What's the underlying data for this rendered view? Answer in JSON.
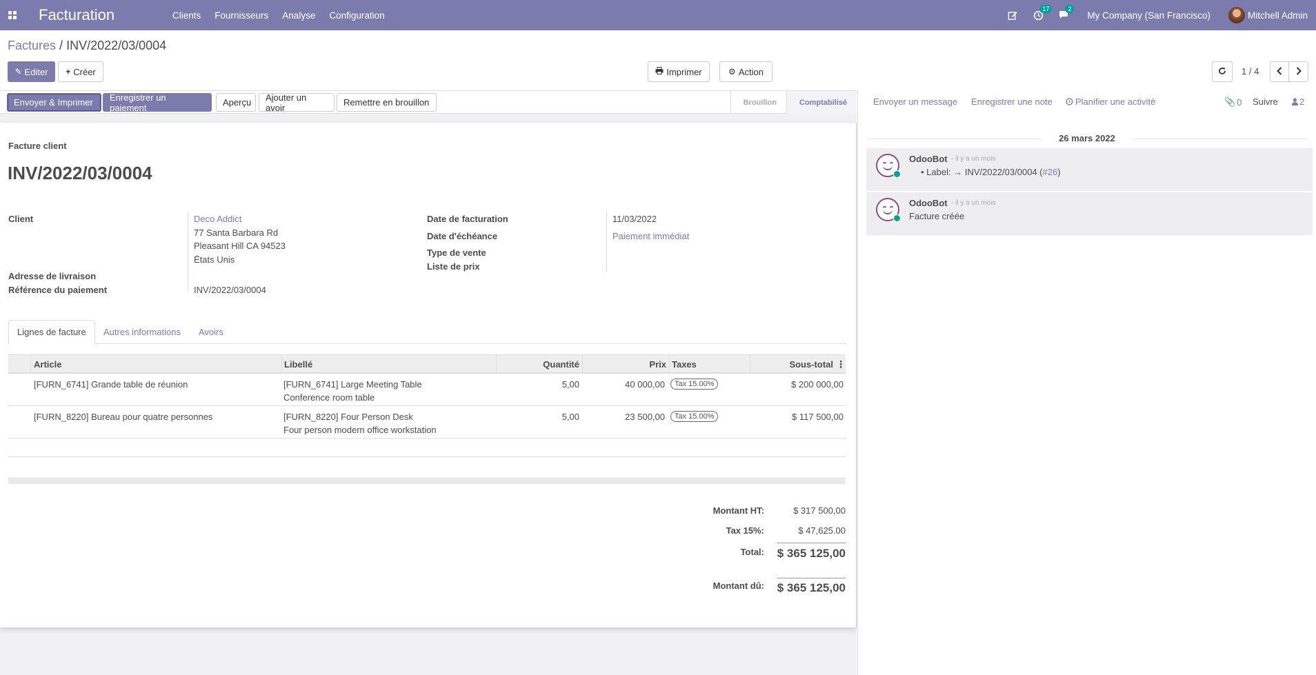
{
  "navbar": {
    "app_name": "Facturation",
    "menu": [
      "Clients",
      "Fournisseurs",
      "Analyse",
      "Configuration"
    ],
    "activity_count": "17",
    "message_count": "2",
    "company": "My Company (San Francisco)",
    "user": "Mitchell Admin"
  },
  "breadcrumb": {
    "parent": "Factures",
    "separator": "/",
    "current": "INV/2022/03/0004"
  },
  "control": {
    "edit_label": "Editer",
    "create_label": "Créer",
    "print_label": "Imprimer",
    "action_label": "Action",
    "pager": "1 / 4"
  },
  "statusbar": {
    "buttons": [
      "Envoyer & Imprimer",
      "Enregistrer un paiement",
      "Aperçu",
      "Ajouter un avoir",
      "Remettre en brouillon"
    ],
    "stages": [
      "Brouillon",
      "Comptabilisé"
    ],
    "active_stage": "Comptabilisé"
  },
  "invoice": {
    "type_label": "Facture client",
    "number": "INV/2022/03/0004",
    "labels": {
      "client": "Client",
      "delivery": "Adresse de livraison",
      "payment_ref": "Référence du paiement",
      "invoice_date": "Date de facturation",
      "due_date": "Date d'échéance",
      "sale_type": "Type de vente",
      "pricelist": "Liste de prix"
    },
    "client_name": "Deco Addict",
    "client_address": [
      "77 Santa Barbara Rd",
      "Pleasant Hill CA 94523",
      "États Unis"
    ],
    "payment_ref": "INV/2022/03/0004",
    "invoice_date": "11/03/2022",
    "due_date": "Paiement immédiat"
  },
  "tabs": [
    "Lignes de facture",
    "Autres informations",
    "Avoirs"
  ],
  "lines": {
    "headers": [
      "Article",
      "Libellé",
      "Quantité",
      "Prix",
      "Taxes",
      "Sous-total"
    ],
    "rows": [
      {
        "article": "[FURN_6741] Grande table de réunion",
        "label1": "[FURN_6741] Large Meeting Table",
        "label2": "Conference room table",
        "qty": "5,00",
        "price": "40 000,00",
        "tax": "Tax 15.00%",
        "subtotal": "$ 200 000,00"
      },
      {
        "article": "[FURN_8220] Bureau pour quatre personnes",
        "label1": "[FURN_8220] Four Person Desk",
        "label2": "Four person modern office workstation",
        "qty": "5,00",
        "price": "23 500,00",
        "tax": "Tax 15.00%",
        "subtotal": "$ 117 500,00"
      }
    ]
  },
  "totals": {
    "untaxed_label": "Montant HT:",
    "untaxed": "$ 317 500,00",
    "tax_label": "Tax 15%:",
    "tax": "$ 47,625.00",
    "total_label": "Total:",
    "total": "$ 365 125,00",
    "due_label": "Montant dû:",
    "due": "$ 365 125,00"
  },
  "chatter": {
    "send_message": "Envoyer un message",
    "log_note": "Enregistrer une note",
    "schedule": "Planifier une activité",
    "attachments": "0",
    "follow": "Suivre",
    "followers": "2",
    "date": "26 mars 2022",
    "messages": [
      {
        "author": "OdooBot",
        "time": "- il y a un mois",
        "prefix": "Label:",
        "arrow": "→",
        "value": "INV/2022/03/0004 (",
        "link": "#26",
        "suffix": ")"
      },
      {
        "author": "OdooBot",
        "time": "- il y a un mois",
        "body": "Facture créée"
      }
    ]
  }
}
